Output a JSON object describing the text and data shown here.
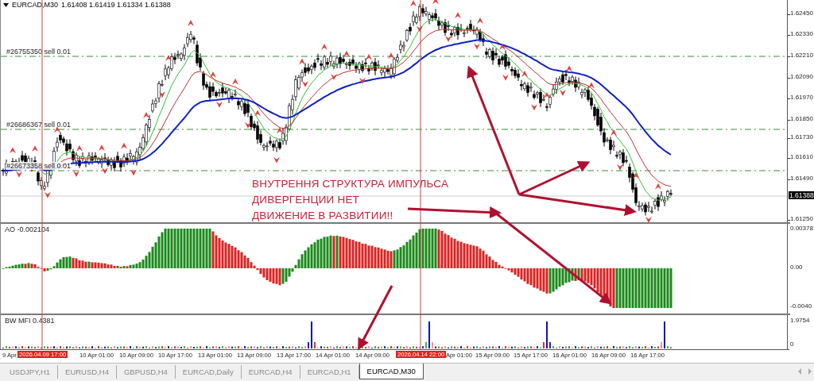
{
  "chart": {
    "symbol": "EURCAD,M30",
    "ohlc": "1.61408 1.61419 1.61334 1.61388",
    "price_axis": [
      "1.62450",
      "1.62330",
      "1.62210",
      "1.62090",
      "1.61970",
      "1.61850",
      "1.61730",
      "1.61610",
      "1.61490",
      "1.61250"
    ],
    "current_price": "1.61388",
    "order_lines": [
      {
        "label": "#26755350 sell 0.01"
      },
      {
        "label": "#26686367 sell 0.01"
      },
      {
        "label": "#26673358 sell 0.01"
      }
    ],
    "annotation": [
      "ВНУТРЕННЯ СТРУКТУРА ИМПУЛЬСА",
      "ДИВЕРГЕНЦИИ НЕТ",
      "ДВИЖЕНИЕ В РАЗВИТИИ!!"
    ]
  },
  "ao": {
    "label": "AO -0.002104",
    "axis": [
      "0.00378",
      "0.00",
      "-0.0040"
    ]
  },
  "bw_mfi": {
    "label": "BW MFI 0.4381",
    "axis": [
      "1.9754",
      "0"
    ]
  },
  "time_axis": {
    "labels": [
      "9 Apr",
      "10 Apr 01:00",
      "10 Apr 09:00",
      "10 Apr 17:00",
      "13 Apr 01:00",
      "13 Apr 09:00",
      "13 Apr 17:00",
      "14 Apr 01:00",
      "14 Apr 09:00",
      "Apr 01:00",
      "15 Apr 09:00",
      "15 Apr 17:00",
      "16 Apr 01:00",
      "16 Apr 09:00",
      "16 Apr 17:00"
    ],
    "markers": [
      {
        "label": "2026.04.09 17:00"
      },
      {
        "label": "2026.04.14 22:00"
      }
    ]
  },
  "tabs": [
    {
      "label": "USDJPY,H1",
      "selected": false
    },
    {
      "label": "EURUSD,H4",
      "selected": false
    },
    {
      "label": "GBPUSD,H4",
      "selected": false
    },
    {
      "label": "EURCAD,Daily",
      "selected": false
    },
    {
      "label": "EURCAD,H4",
      "selected": false
    },
    {
      "label": "EURCAD,H1",
      "selected": false
    },
    {
      "label": "EURCAD,M30",
      "selected": true
    }
  ]
}
